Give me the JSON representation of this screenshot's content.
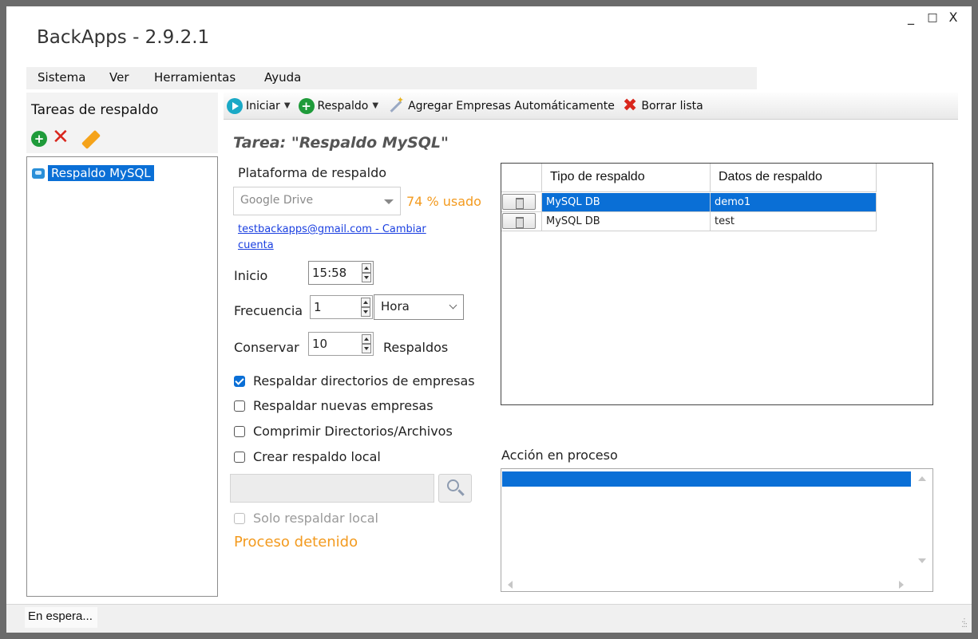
{
  "window": {
    "title": "BackApps - 2.9.2.1",
    "controls": {
      "minimize": "_",
      "maximize": "□",
      "close": "X"
    }
  },
  "menu": [
    "Sistema",
    "Ver",
    "Herramientas",
    "Ayuda"
  ],
  "sidebar": {
    "title": "Tareas de respaldo",
    "tools": {
      "add_icon": "plus-circle-icon",
      "delete_icon": "red-x-icon",
      "edit_icon": "pencil-icon"
    },
    "items": [
      {
        "label": "Respaldo MySQL",
        "icon": "database-icon",
        "selected": true
      }
    ]
  },
  "toolbar": {
    "start_label": "Iniciar",
    "backup_label": "Respaldo",
    "auto_add_label": "Agregar Empresas Automáticamente",
    "clear_label": "Borrar lista"
  },
  "task": {
    "title": "Tarea: \"Respaldo MySQL\"",
    "platform_label": "Plataforma de respaldo",
    "platform_value": "Google Drive",
    "usage": "74 % usado",
    "account_link": "testbackapps@gmail.com - Cambiar cuenta",
    "start_label": "Inicio",
    "start_value": "15:58",
    "frequency_label": "Frecuencia",
    "frequency_value": "1",
    "frequency_unit": "Hora",
    "keep_label": "Conservar",
    "keep_value": "10",
    "keep_suffix": "Respaldos",
    "options": [
      {
        "label": "Respaldar directorios de empresas",
        "checked": true
      },
      {
        "label": "Respaldar nuevas empresas",
        "checked": false
      },
      {
        "label": "Comprimir Directorios/Archivos",
        "checked": false
      },
      {
        "label": "Crear respaldo local",
        "checked": false
      }
    ],
    "local_only_label": "Solo respaldar local",
    "process_status": "Proceso detenido"
  },
  "grid": {
    "columns": [
      "Tipo de respaldo",
      "Datos de respaldo"
    ],
    "rows": [
      {
        "type": "MySQL DB",
        "data": "demo1",
        "selected": true
      },
      {
        "type": "MySQL DB",
        "data": "test",
        "selected": false
      }
    ]
  },
  "action": {
    "label": "Acción en proceso"
  },
  "statusbar": {
    "text": "En espera..."
  },
  "colors": {
    "accent": "#0a6fd6",
    "warning": "#f39a1e",
    "link": "#1a3fe0",
    "delete": "#d9261c",
    "add": "#1f9b3a"
  }
}
